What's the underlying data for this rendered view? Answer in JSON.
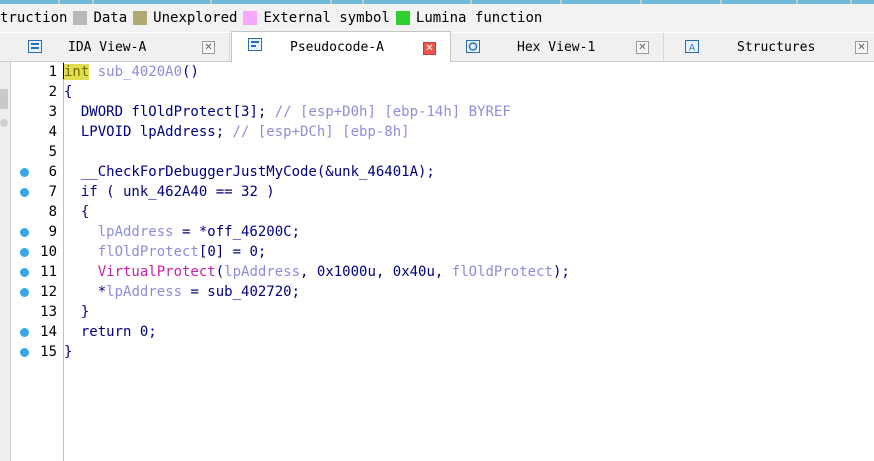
{
  "legend": [
    {
      "label": "truction",
      "color": ""
    },
    {
      "label": "Data",
      "color": "#b8b8b8"
    },
    {
      "label": "Unexplored",
      "color": "#b0aa72"
    },
    {
      "label": "External symbol",
      "color": "#f8a8f8"
    },
    {
      "label": "Lumina function",
      "color": "#2fcf2f"
    }
  ],
  "tabs": [
    {
      "label": "IDA View-A",
      "icon": "ida-view-icon",
      "active": false
    },
    {
      "label": "Pseudocode-A",
      "icon": "pseudocode-icon",
      "active": true
    },
    {
      "label": "Hex View-1",
      "icon": "hex-view-icon",
      "active": false
    },
    {
      "label": "Structures",
      "icon": "structures-icon",
      "active": false
    }
  ],
  "tab_close_glyph": "✕",
  "left_edge_glyph": "ㄴ",
  "colors": {
    "keyword": "#000080",
    "comment": "#8d8ddb",
    "function": "#cc1ea7",
    "breakpoint_dot": "#38a7e8",
    "highlight": "#dede4e"
  },
  "code": {
    "lines": [
      {
        "num": "1",
        "dot": false,
        "tokens": [
          {
            "t": "int",
            "c": "hl"
          },
          {
            "t": " sub_4020A0",
            "c": "var"
          },
          {
            "t": "()",
            "c": "k"
          }
        ]
      },
      {
        "num": "2",
        "dot": false,
        "tokens": [
          {
            "t": "{",
            "c": "k"
          }
        ]
      },
      {
        "num": "3",
        "dot": false,
        "tokens": [
          {
            "t": "  DWORD flOldProtect[",
            "c": "k"
          },
          {
            "t": "3",
            "c": "n"
          },
          {
            "t": "]; ",
            "c": "k"
          },
          {
            "t": "// [esp+D0h] [ebp-14h] BYREF",
            "c": "c"
          }
        ]
      },
      {
        "num": "4",
        "dot": false,
        "tokens": [
          {
            "t": "  LPVOID lpAddress; ",
            "c": "k"
          },
          {
            "t": "// [esp+DCh] [ebp-8h]",
            "c": "c"
          }
        ]
      },
      {
        "num": "5",
        "dot": false,
        "tokens": []
      },
      {
        "num": "6",
        "dot": true,
        "tokens": [
          {
            "t": "  __CheckForDebuggerJustMyCode(&unk_46401A);",
            "c": "k"
          }
        ]
      },
      {
        "num": "7",
        "dot": true,
        "tokens": [
          {
            "t": "  if ( unk_462A40 == ",
            "c": "k"
          },
          {
            "t": "32",
            "c": "n"
          },
          {
            "t": " )",
            "c": "k"
          }
        ]
      },
      {
        "num": "8",
        "dot": false,
        "tokens": [
          {
            "t": "  {",
            "c": "k"
          }
        ]
      },
      {
        "num": "9",
        "dot": true,
        "tokens": [
          {
            "t": "    ",
            "c": "k"
          },
          {
            "t": "lpAddress",
            "c": "var"
          },
          {
            "t": " = *off_46200C;",
            "c": "k"
          }
        ]
      },
      {
        "num": "10",
        "dot": true,
        "tokens": [
          {
            "t": "    ",
            "c": "k"
          },
          {
            "t": "flOldProtect",
            "c": "var"
          },
          {
            "t": "[",
            "c": "k"
          },
          {
            "t": "0",
            "c": "n"
          },
          {
            "t": "] = ",
            "c": "k"
          },
          {
            "t": "0",
            "c": "n"
          },
          {
            "t": ";",
            "c": "k"
          }
        ]
      },
      {
        "num": "11",
        "dot": true,
        "tokens": [
          {
            "t": "    ",
            "c": "k"
          },
          {
            "t": "VirtualProtect",
            "c": "fn"
          },
          {
            "t": "(",
            "c": "k"
          },
          {
            "t": "lpAddress",
            "c": "var"
          },
          {
            "t": ", ",
            "c": "k"
          },
          {
            "t": "0x1000u",
            "c": "n"
          },
          {
            "t": ", ",
            "c": "k"
          },
          {
            "t": "0x40u",
            "c": "n"
          },
          {
            "t": ", ",
            "c": "k"
          },
          {
            "t": "flOldProtect",
            "c": "var"
          },
          {
            "t": ");",
            "c": "k"
          }
        ]
      },
      {
        "num": "12",
        "dot": true,
        "tokens": [
          {
            "t": "    *",
            "c": "k"
          },
          {
            "t": "lpAddress",
            "c": "var"
          },
          {
            "t": " = sub_402720;",
            "c": "k"
          }
        ]
      },
      {
        "num": "13",
        "dot": false,
        "tokens": [
          {
            "t": "  }",
            "c": "k"
          }
        ]
      },
      {
        "num": "14",
        "dot": true,
        "tokens": [
          {
            "t": "  return ",
            "c": "k"
          },
          {
            "t": "0",
            "c": "n"
          },
          {
            "t": ";",
            "c": "k"
          }
        ]
      },
      {
        "num": "15",
        "dot": true,
        "tokens": [
          {
            "t": "}",
            "c": "k"
          }
        ]
      }
    ]
  }
}
